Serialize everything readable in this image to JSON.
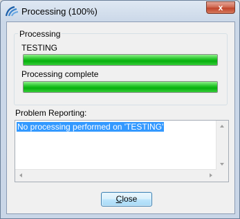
{
  "window": {
    "title": "Processing (100%)",
    "close_glyph": "x"
  },
  "processing_group": {
    "legend": "Processing",
    "current_item": "TESTING",
    "item_progress": 1.0,
    "status_text": "Processing complete",
    "overall_progress": 1.0
  },
  "problem_reporting": {
    "label": "Problem Reporting:",
    "text": "No processing performed on 'TESTING'"
  },
  "buttons": {
    "close_label_underlined": "C",
    "close_label_rest": "lose"
  },
  "colors": {
    "progress_green": "#06b00d",
    "selection_blue": "#3399ff"
  },
  "icons": {
    "app": "app-logo-icon",
    "close": "close-icon"
  }
}
